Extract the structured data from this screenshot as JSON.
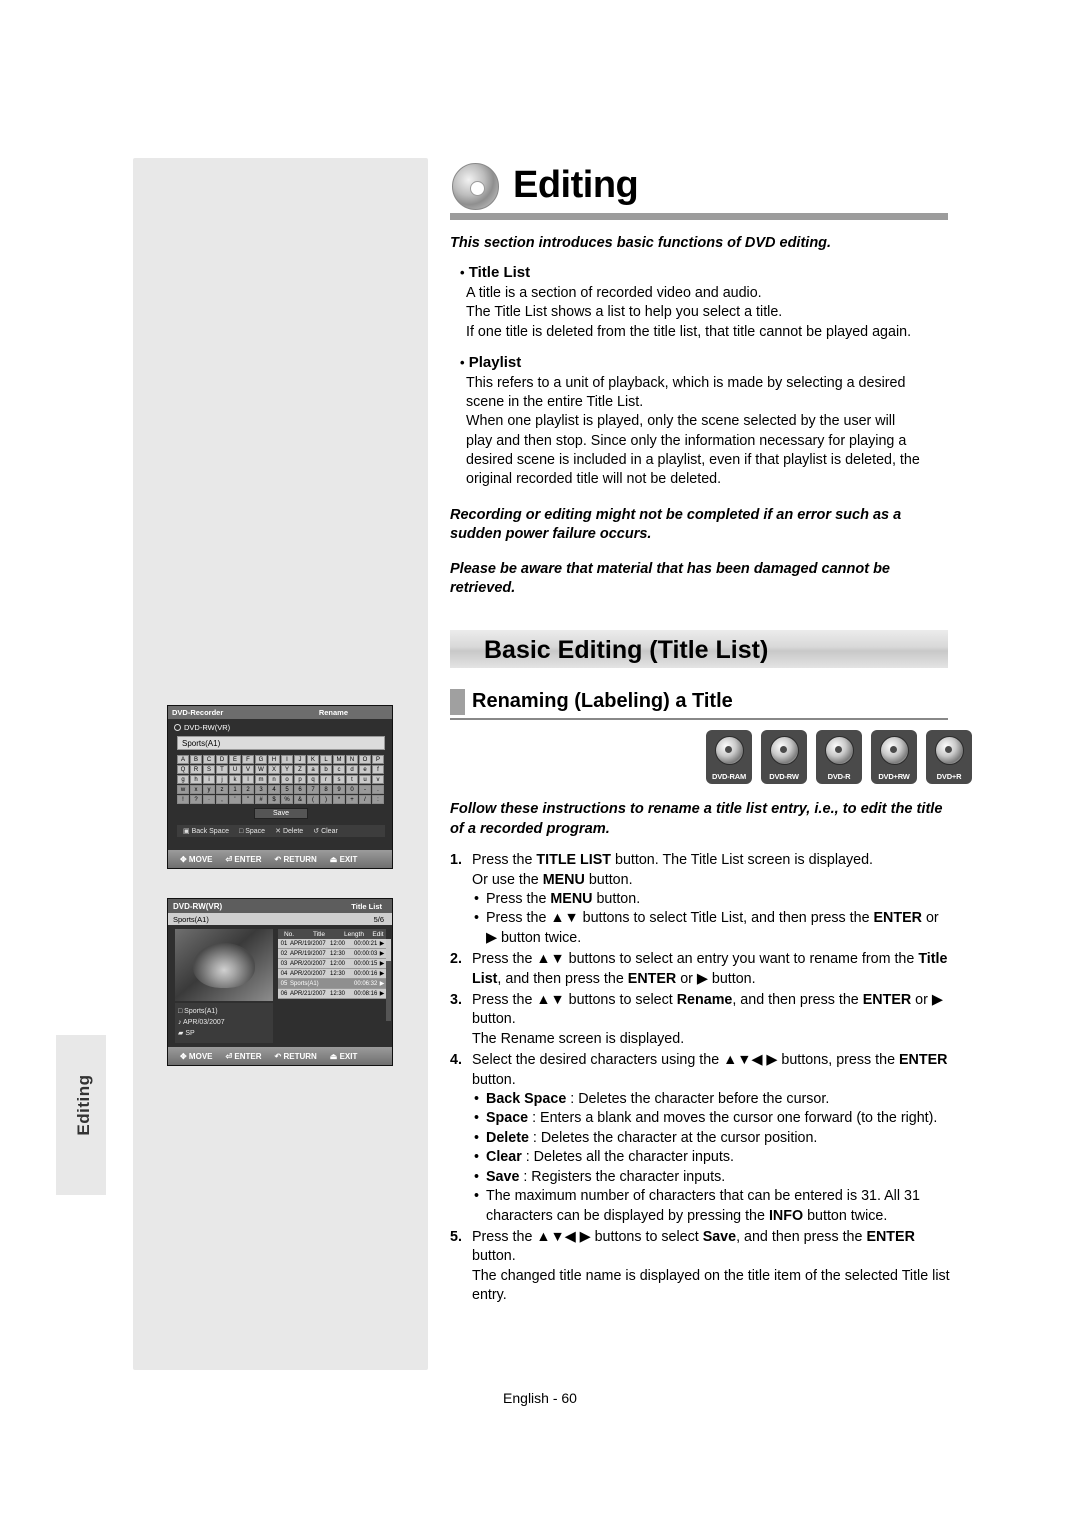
{
  "page": {
    "chapter_tab": "Editing",
    "title": "Editing",
    "footer": "English - 60"
  },
  "intro": {
    "lead": "This section introduces basic functions of DVD editing.",
    "sections": [
      {
        "heading": "Title List",
        "lines": [
          "A title is a section of recorded video and audio.",
          "The Title List shows a list to help you select a title.",
          "If one title is deleted from the title list, that title cannot be played again."
        ]
      },
      {
        "heading": "Playlist",
        "lines": [
          "This refers to a unit of playback, which is made by selecting a desired",
          "scene in the entire Title List.",
          "When one playlist is played, only the scene selected by the user will",
          "play and then stop. Since only the information necessary for playing a",
          "desired scene is included in a playlist, even if that playlist is deleted, the",
          "original recorded title will not be deleted."
        ]
      }
    ],
    "warnings": [
      "Recording or editing might not be completed if an error such as a sudden power failure occurs.",
      "Please be aware that material that has been damaged cannot be retrieved."
    ]
  },
  "banner": {
    "title": "Basic Editing (Title List)"
  },
  "subsection": {
    "title": "Renaming (Labeling) a Title"
  },
  "disc_logos": [
    "DVD-RAM",
    "DVD-RW",
    "DVD-R",
    "DVD+RW",
    "DVD+R"
  ],
  "instructions": {
    "lead": "Follow these instructions to rename a title list entry, i.e., to edit the title of a recorded program.",
    "steps": [
      {
        "num": "1.",
        "text_html": "Press the <b>TITLE LIST</b> button. The Title List screen is displayed.",
        "lines": [
          "Or use the <b>MENU</b> button."
        ],
        "subs": [
          "Press the <b>MENU</b> button.",
          "Press the ▲▼ buttons to select Title List, and then press the <b>ENTER</b> or ▶ button twice."
        ]
      },
      {
        "num": "2.",
        "text_html": "Press the ▲▼ buttons to select an entry you want to rename from the <b>Title List</b>, and then press the <b>ENTER</b> or ▶ button.",
        "lines": [],
        "subs": []
      },
      {
        "num": "3.",
        "text_html": "Press the ▲▼ buttons to select <b>Rename</b>, and then press the <b>ENTER</b> or ▶ button.",
        "lines": [
          "The Rename screen is displayed."
        ],
        "subs": []
      },
      {
        "num": "4.",
        "text_html": "Select the desired characters using the ▲▼◀ ▶ buttons, press the <b>ENTER</b> button.",
        "lines": [],
        "subs": [
          "<b>Back Space</b> : Deletes the character before the cursor.",
          "<b>Space</b> : Enters a blank and moves the cursor one forward (to the right).",
          "<b>Delete</b> : Deletes the character at the cursor position.",
          "<b>Clear</b> : Deletes all the character inputs.",
          "<b>Save</b> : Registers the character inputs.",
          "The maximum number of characters that can be entered is 31. All 31 characters can be displayed by pressing the <b>INFO</b> button twice."
        ]
      },
      {
        "num": "5.",
        "text_html": "Press the ▲▼◀ ▶ buttons to select <b>Save</b>, and then press the <b>ENTER</b> button.",
        "lines": [
          "The changed title name is displayed on the title item of the selected Title list entry."
        ],
        "subs": []
      }
    ]
  },
  "osd_rename": {
    "topbar_left": "DVD-Recorder",
    "topbar_right": "Rename",
    "disc_label": "DVD-RW(VR)",
    "field_value": "Sports(A1)",
    "keyboard_rows": [
      [
        "A",
        "B",
        "C",
        "D",
        "E",
        "F",
        "G",
        "H",
        "I",
        "J",
        "K",
        "L",
        "M",
        "N",
        "O",
        "P"
      ],
      [
        "Q",
        "R",
        "S",
        "T",
        "U",
        "V",
        "W",
        "X",
        "Y",
        "Z",
        "a",
        "b",
        "c",
        "d",
        "e",
        "f"
      ],
      [
        "g",
        "h",
        "i",
        "j",
        "k",
        "l",
        "m",
        "n",
        "o",
        "p",
        "q",
        "r",
        "s",
        "t",
        "u",
        "v"
      ],
      [
        "w",
        "x",
        "y",
        "z",
        "1",
        "2",
        "3",
        "4",
        "5",
        "6",
        "7",
        "8",
        "9",
        "0",
        "-",
        "."
      ],
      [
        "!",
        "?",
        "·",
        ",",
        "'",
        "\"",
        "#",
        "$",
        "%",
        "&",
        "(",
        ")",
        "*",
        "+",
        "/",
        ":"
      ]
    ],
    "save_label": "Save",
    "functions": [
      "Back Space",
      "Space",
      "Delete",
      "Clear"
    ],
    "nav": [
      "MOVE",
      "ENTER",
      "RETURN",
      "EXIT"
    ]
  },
  "osd_titlelist": {
    "topbar_left": "DVD-RW(VR)",
    "topbar_right": "Title List",
    "sub_left": "Sports(A1)",
    "sub_right": "5/6",
    "meta": [
      "Sports(A1)",
      "APR/03/2007",
      "SP"
    ],
    "columns": [
      "No.",
      "Title",
      "Length",
      "Edit"
    ],
    "rows": [
      {
        "no": "01",
        "title": "APR/19/2007",
        "time": "12:00",
        "length": "00:00:21",
        "edit": "▶"
      },
      {
        "no": "02",
        "title": "APR/19/2007",
        "time": "12:30",
        "length": "00:00:03",
        "edit": "▶"
      },
      {
        "no": "03",
        "title": "APR/20/2007",
        "time": "12:00",
        "length": "00:00:15",
        "edit": "▶"
      },
      {
        "no": "04",
        "title": "APR/20/2007",
        "time": "12:30",
        "length": "00:00:16",
        "edit": "▶"
      },
      {
        "no": "05",
        "title": "Sports(A1)",
        "time": "",
        "length": "00:06:32",
        "edit": "▶"
      },
      {
        "no": "06",
        "title": "APR/21/2007",
        "time": "12:30",
        "length": "00:08:16",
        "edit": "▶"
      }
    ],
    "nav": [
      "MOVE",
      "ENTER",
      "RETURN",
      "EXIT"
    ]
  }
}
